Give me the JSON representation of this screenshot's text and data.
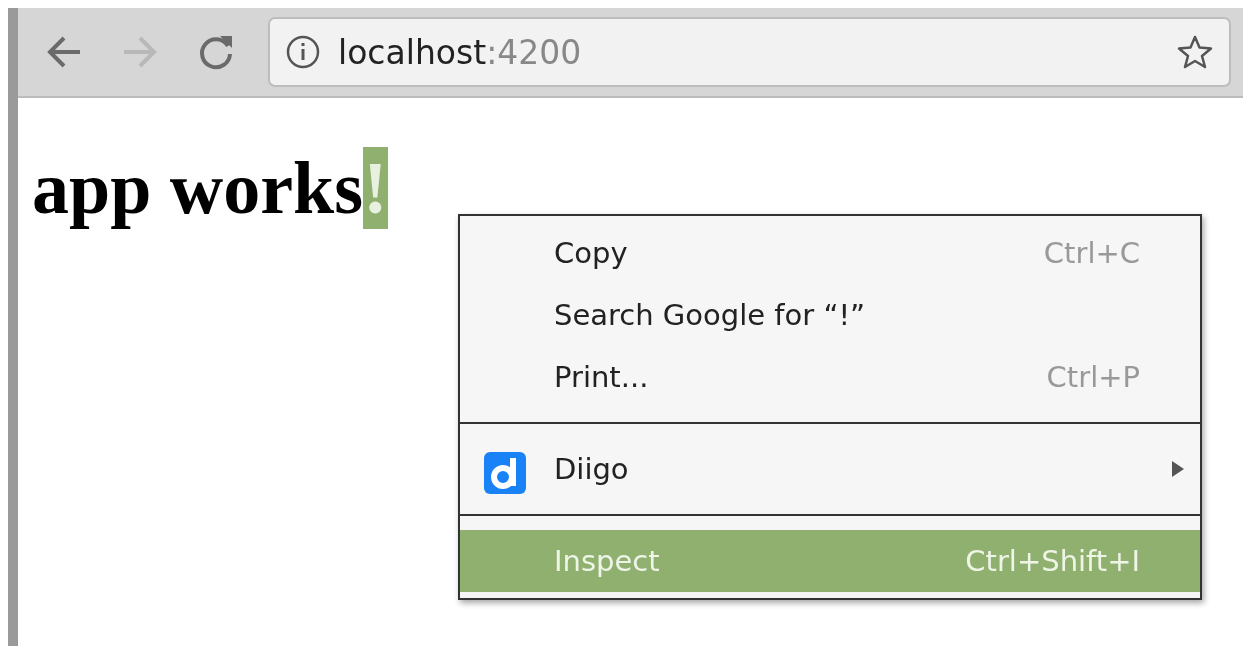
{
  "toolbar": {
    "back": {
      "disabled": false
    },
    "forward": {
      "disabled": true
    },
    "address": {
      "host": "localhost",
      "port": ":4200"
    }
  },
  "page": {
    "heading": "app works",
    "selection": "!"
  },
  "context_menu": {
    "items": [
      {
        "kind": "item",
        "label": "Copy",
        "shortcut": "Ctrl+C",
        "selected": false
      },
      {
        "kind": "item",
        "label": "Search Google for “!”",
        "selected": false
      },
      {
        "kind": "item",
        "label": "Print...",
        "shortcut": "Ctrl+P",
        "selected": false
      },
      {
        "kind": "separator"
      },
      {
        "kind": "extension",
        "label": "Diigo",
        "selected": false
      },
      {
        "kind": "separator"
      },
      {
        "kind": "item",
        "label": "Inspect",
        "shortcut": "Ctrl+Shift+I",
        "selected": true
      }
    ]
  }
}
